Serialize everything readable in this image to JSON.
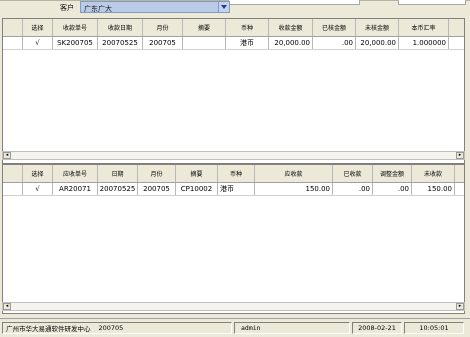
{
  "customer": {
    "label": "客户",
    "value": "广东广大"
  },
  "grid1": {
    "columns": [
      "选择",
      "收款单号",
      "收款日期",
      "月份",
      "摘要",
      "币种",
      "收款金额",
      "已核金额",
      "未核金额",
      "本币汇率"
    ],
    "rows": [
      [
        "√",
        "SK200705",
        "20070525",
        "200705",
        "",
        "港币",
        "20,000.00",
        ".00",
        "20,000.00",
        "1.000000"
      ]
    ]
  },
  "grid2": {
    "columns": [
      "选择",
      "应收单号",
      "日期",
      "月份",
      "摘要",
      "币种",
      "应收款",
      "已收款",
      "调整金额",
      "未收款"
    ],
    "rows": [
      [
        "√",
        "AR20071",
        "20070525",
        "200705",
        "CP10002",
        "港币",
        "150.00",
        ".00",
        ".00",
        "150.00"
      ]
    ]
  },
  "status": {
    "company": "广州市华大易通软件研发中心",
    "period": "200705",
    "user": "admin",
    "date": "2008-02-21",
    "time": "10:05:01"
  }
}
